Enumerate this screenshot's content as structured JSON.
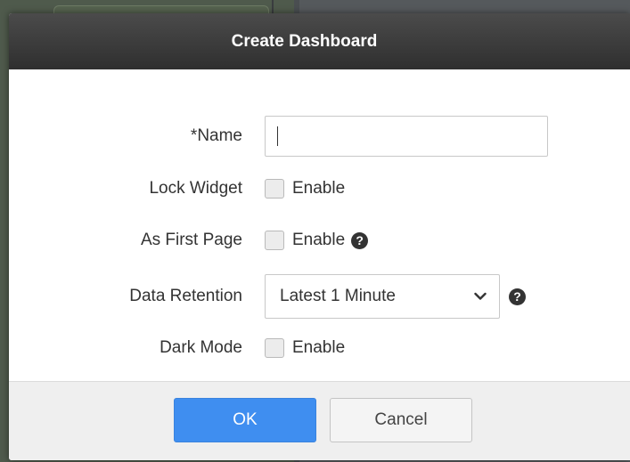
{
  "dialog": {
    "title": "Create Dashboard",
    "fields": {
      "name": {
        "label": "*Name",
        "value": "",
        "placeholder": ""
      },
      "lock_widget": {
        "label": "Lock Widget",
        "option_label": "Enable",
        "checked": false
      },
      "as_first_page": {
        "label": "As First Page",
        "option_label": "Enable",
        "checked": false,
        "help_icon": "question-circle-icon"
      },
      "data_retention": {
        "label": "Data Retention",
        "selected": "Latest 1 Minute",
        "help_icon": "question-circle-icon"
      },
      "dark_mode": {
        "label": "Dark Mode",
        "option_label": "Enable",
        "checked": false
      }
    },
    "buttons": {
      "ok": "OK",
      "cancel": "Cancel"
    }
  },
  "help_glyph": "?",
  "colors": {
    "header_bg": "#3c3c3c",
    "primary_button": "#3f8ef0",
    "footer_bg": "#efefef",
    "checkbox_bg": "#ececec"
  }
}
